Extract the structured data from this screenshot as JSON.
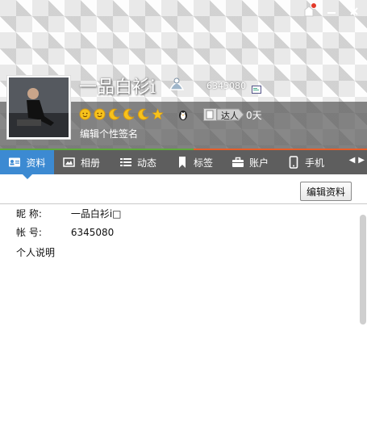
{
  "window": {
    "controls": {
      "skin_icon": "skin-icon",
      "minimize_icon": "minimize-icon",
      "close_icon": "close-icon"
    }
  },
  "profile": {
    "nickname": "一品白衫i",
    "account_number": "6345080",
    "signature": "编辑个性签名",
    "talent_label": "达人",
    "days": "0天",
    "level_icons": [
      "sun",
      "sun",
      "moon",
      "moon",
      "moon",
      "star"
    ]
  },
  "tabs": [
    {
      "label": "资料",
      "icon": "profile-card-icon",
      "active": true
    },
    {
      "label": "相册",
      "icon": "album-icon",
      "active": false
    },
    {
      "label": "动态",
      "icon": "list-icon",
      "active": false
    },
    {
      "label": "标签",
      "icon": "bookmark-icon",
      "active": false
    },
    {
      "label": "账户",
      "icon": "briefcase-icon",
      "active": false
    },
    {
      "label": "手机",
      "icon": "phone-icon",
      "active": false
    }
  ],
  "toolbar": {
    "edit_button_label": "编辑资料"
  },
  "details": {
    "nickname_label": "昵    称:",
    "nickname_value": "一品白衫i□",
    "account_label": "帐    号:",
    "account_value": "6345080",
    "description_label": "个人说明"
  },
  "colors": {
    "active_tab": "#3c8ad2",
    "tab_bar": "#5e5e5e",
    "green_accent": "#5faa3b",
    "orange_accent": "#e65e2a"
  }
}
